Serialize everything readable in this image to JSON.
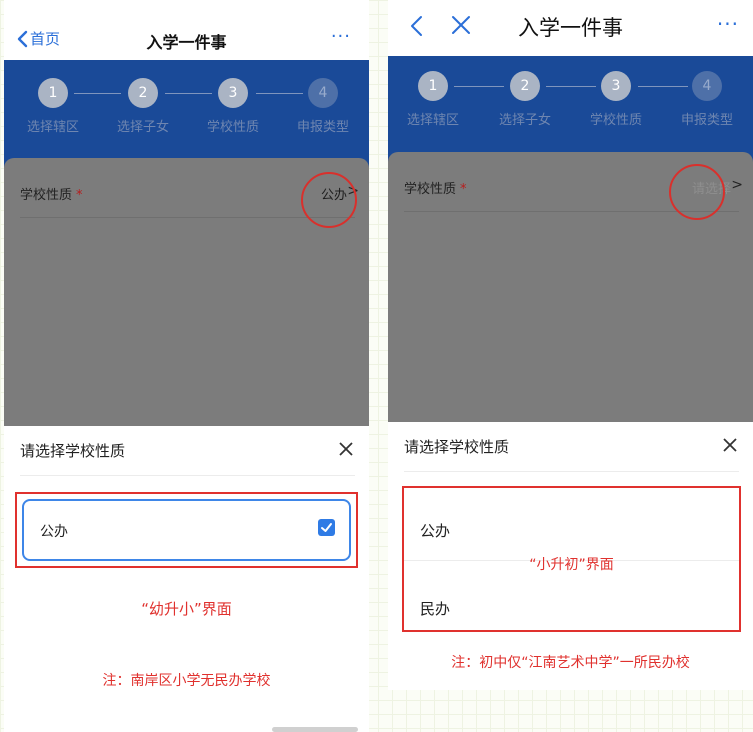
{
  "left": {
    "nav": {
      "back_label": "首页",
      "title": "入学一件事",
      "more": "···"
    },
    "steps": [
      {
        "number": "1",
        "label": "选择辖区"
      },
      {
        "number": "2",
        "label": "选择子女"
      },
      {
        "number": "3",
        "label": "学校性质"
      },
      {
        "number": "4",
        "label": "申报类型"
      }
    ],
    "field": {
      "label": "学校性质",
      "required_mark": "*",
      "value": "公办",
      "chevron": ">"
    },
    "sheet": {
      "title": "请选择学校性质",
      "options": [
        {
          "label": "公办",
          "selected": true
        }
      ]
    },
    "annotation_title": "“幼升小”界面",
    "annotation_note": "注：南岸区小学无民办学校"
  },
  "right": {
    "nav": {
      "title": "入学一件事",
      "more": "···"
    },
    "steps": [
      {
        "number": "1",
        "label": "选择辖区"
      },
      {
        "number": "2",
        "label": "选择子女"
      },
      {
        "number": "3",
        "label": "学校性质"
      },
      {
        "number": "4",
        "label": "申报类型"
      }
    ],
    "field": {
      "label": "学校性质",
      "required_mark": "*",
      "placeholder": "请选择",
      "chevron": ">"
    },
    "sheet": {
      "title": "请选择学校性质",
      "options": [
        {
          "label": "公办"
        },
        {
          "label": "民办"
        }
      ]
    },
    "annotation_title": "“小升初”界面",
    "annotation_note": "注：初中仅“江南艺术中学”一所民办校"
  },
  "colors": {
    "accent": "#2b6fd8",
    "band": "#1a4a98",
    "overlay": "#7c7c7c",
    "annotation_red": "#e0312e",
    "checkbox_blue": "#2f7be5"
  }
}
